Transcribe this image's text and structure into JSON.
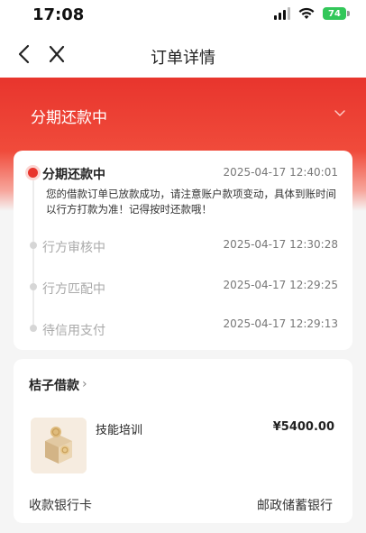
{
  "status_bar": {
    "time": "17:08",
    "battery": "74",
    "icons": [
      "signal-icon",
      "wifi-icon",
      "battery-icon"
    ]
  },
  "nav": {
    "title": "订单详情",
    "back_icon": "chevron-left-icon",
    "close_icon": "close-icon"
  },
  "header": {
    "status": "分期还款中",
    "expand_icon": "chevron-down-icon"
  },
  "progress": {
    "steps": [
      {
        "title": "分期还款中",
        "time": "2025-04-17 12:40:01",
        "desc": "您的借款订单已放款成功，请注意账户款项变动，具体到账时间以行方打款为准！记得按时还款哦！"
      },
      {
        "title": "行方审核中",
        "time": "2025-04-17 12:30:28"
      },
      {
        "title": "行方匹配中",
        "time": "2025-04-17 12:29:25"
      },
      {
        "title": "待信用支付",
        "time": "2025-04-17 12:29:13"
      }
    ]
  },
  "order": {
    "merchant": "桔子借款",
    "merchant_chevron": "›",
    "product_name": "技能培训",
    "price": "¥5400.00",
    "bank_label": "收款银行卡",
    "bank_value": "邮政储蓄银行"
  },
  "colors": {
    "accent_red": "#e8352d",
    "page_bg": "#f5f5f5",
    "battery_green": "#32c759"
  }
}
